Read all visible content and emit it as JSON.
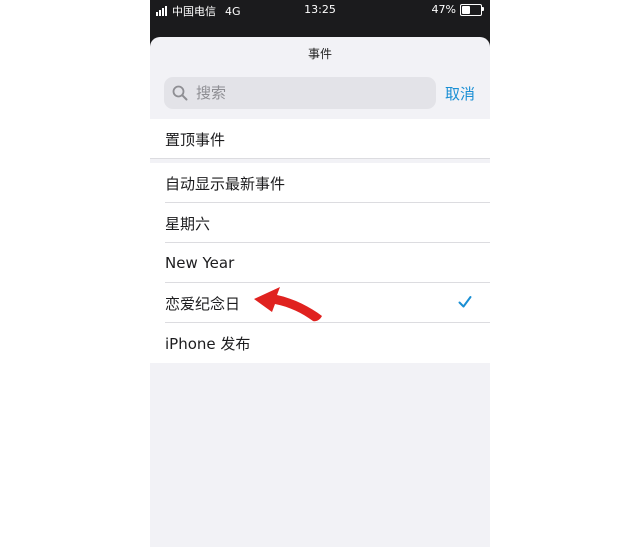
{
  "status_bar": {
    "carrier": "中国电信",
    "network": "4G",
    "time": "13:25",
    "battery_text": "47%",
    "battery_level": 0.47
  },
  "sheet": {
    "title": "事件"
  },
  "search": {
    "placeholder": "搜索",
    "cancel_label": "取消"
  },
  "list": {
    "items": [
      {
        "label": "置顶事件"
      },
      {
        "label": "自动显示最新事件"
      },
      {
        "label": "星期六"
      },
      {
        "label": "New Year"
      },
      {
        "label": "恋爱纪念日",
        "selected": true
      },
      {
        "label": "iPhone 发布"
      }
    ]
  },
  "colors": {
    "accent": "#1a8fd4",
    "annotation_arrow": "#e0221f",
    "sheet_background": "#f2f2f6"
  },
  "icons": {
    "search": "search-icon",
    "check": "checkmark-icon",
    "signal": "signal-bars-icon",
    "battery": "battery-icon",
    "arrow": "annotation-arrow-icon"
  }
}
